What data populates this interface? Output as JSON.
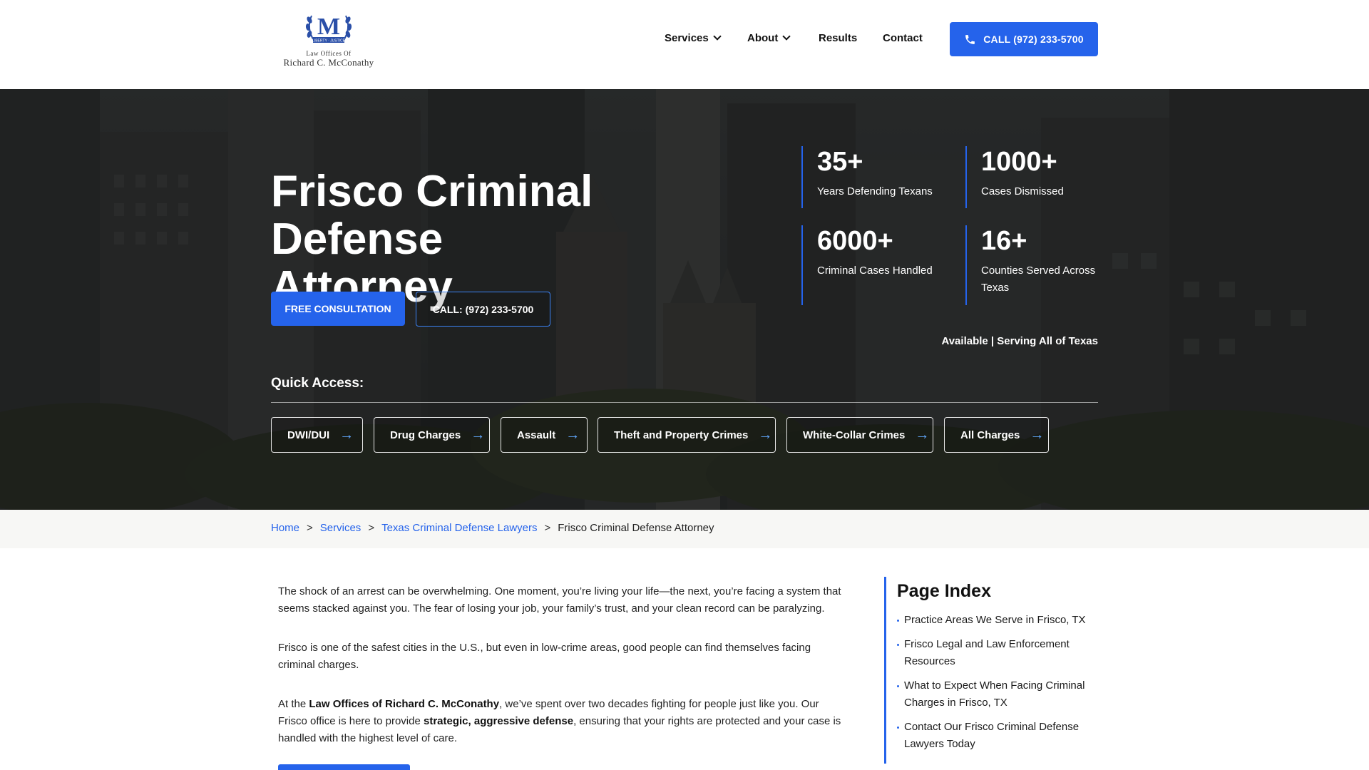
{
  "header": {
    "logo": {
      "monogram": "M",
      "banner": "LIBERTY · JUSTICE",
      "line1": "Law Offices Of",
      "line2": "Richard C. McConathy"
    },
    "nav": [
      {
        "label": "Services",
        "has_dropdown": true
      },
      {
        "label": "About",
        "has_dropdown": true
      },
      {
        "label": "Results",
        "has_dropdown": false
      },
      {
        "label": "Contact",
        "has_dropdown": false
      }
    ],
    "call_label": "CALL (972) 233-5700"
  },
  "hero": {
    "title_line1": "Frisco Criminal Defense",
    "title_line2": "Attorney",
    "consult_label": "FREE CONSULTATION",
    "call_label": "CALL: (972) 233-5700",
    "stats": [
      {
        "num": "35+",
        "label": "Years Defending Texans"
      },
      {
        "num": "1000+",
        "label": "Cases Dismissed"
      },
      {
        "num": "6000+",
        "label": "Criminal Cases Handled"
      },
      {
        "num": "16+",
        "label": "Counties Served Across Texas"
      }
    ],
    "available_text": "Available | Serving All of Texas",
    "quick_access_title": "Quick Access:",
    "quick_access": [
      "DWI/DUI",
      "Drug Charges",
      "Assault",
      "Theft and Property Crimes",
      "White-Collar Crimes",
      "All Charges"
    ]
  },
  "breadcrumb": {
    "items": [
      "Home",
      "Services",
      "Texas Criminal Defense Lawyers"
    ],
    "current": "Frisco Criminal Defense Attorney",
    "separator": ">"
  },
  "content": {
    "p1": "The shock of an arrest can be overwhelming. One moment, you’re living your life—the next, you’re facing a system that seems stacked against you. The fear of losing your job, your family’s trust, and your clean record can be paralyzing.",
    "p2": "Frisco is one of the safest cities in the U.S., but even in low-crime areas, good people can find themselves facing criminal charges.",
    "p3_a": "At the ",
    "p3_b": "Law Offices of Richard C. McConathy",
    "p3_c": ", we’ve spent over two decades fighting for people just like you. Our Frisco office is here to provide ",
    "p3_d": "strategic, aggressive defense",
    "p3_e": ", ensuring that your rights are protected and your case is handled with the highest level of care."
  },
  "sidebar": {
    "title": "Page Index",
    "items": [
      "Practice Areas We Serve in Frisco, TX",
      "Frisco Legal and Law Enforcement Resources",
      "What to Expect When Facing Criminal Charges in Frisco, TX",
      "Contact Our Frisco Criminal Defense Lawyers Today"
    ]
  },
  "colors": {
    "accent": "#2563eb",
    "hero_overlay": "#0f1214"
  }
}
